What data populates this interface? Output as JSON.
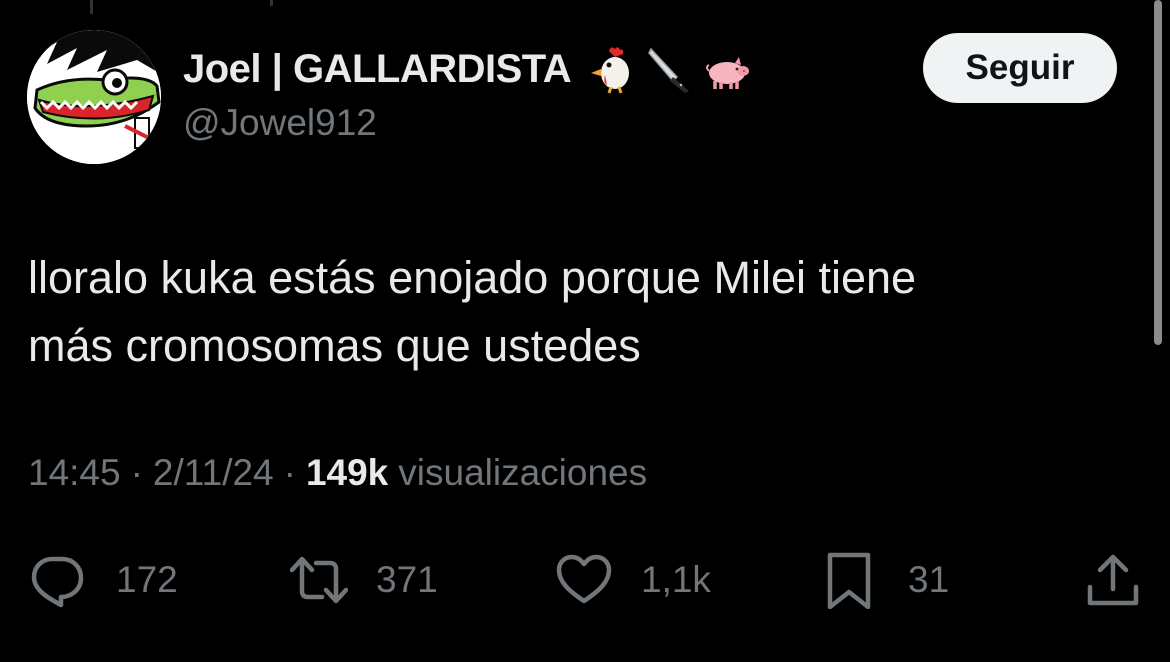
{
  "tweet": {
    "author": {
      "display_name": "Joel | GALLARDISTA",
      "handle": "@Jowel912",
      "emojis": [
        "rooster-emoji",
        "knife-emoji",
        "pig-emoji"
      ]
    },
    "follow_label": "Seguir",
    "text": "lloralo kuka estás enojado porque Milei tiene\nmás cromosomas que ustedes",
    "meta": {
      "time": "14:45",
      "separator": "·",
      "date": "2/11/24",
      "views_count": "149k",
      "views_label": "visualizaciones"
    },
    "actions": {
      "replies": "172",
      "reposts": "371",
      "likes": "1,1k",
      "bookmarks": "31"
    }
  },
  "colors": {
    "background": "#000000",
    "text": "#e7e9ea",
    "secondary_text": "#71767b",
    "button_bg": "#eff3f4",
    "button_text": "#0f1419"
  },
  "icons": [
    "reply-icon",
    "repost-icon",
    "like-icon",
    "bookmark-icon",
    "share-icon"
  ]
}
